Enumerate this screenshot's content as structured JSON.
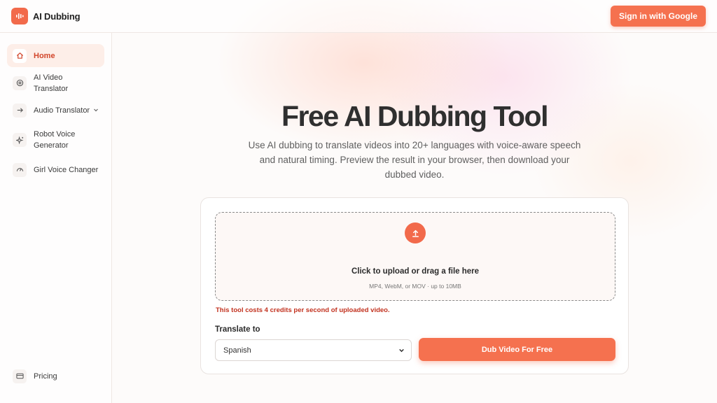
{
  "header": {
    "brand_name": "AI Dubbing",
    "signin_label": "Sign in with Google"
  },
  "sidebar": {
    "items": [
      {
        "label": "Home",
        "icon": "home-icon",
        "active": true
      },
      {
        "label": "AI Video Translator",
        "icon": "target-icon"
      },
      {
        "label": "Audio Translator",
        "icon": "arrow-right-icon",
        "has_submenu": true
      },
      {
        "label": "Robot Voice Generator",
        "icon": "sparkle-icon"
      },
      {
        "label": "Girl Voice Changer",
        "icon": "gauge-icon"
      }
    ],
    "bottom_item": {
      "label": "Pricing",
      "icon": "credit-card-icon"
    }
  },
  "main": {
    "title": "Free AI Dubbing Tool",
    "subtitle": "Use AI dubbing to translate videos into 20+ languages with voice-aware speech and natural timing. Preview the result in your browser, then download your dubbed video.",
    "upload": {
      "title": "Click to upload or drag a file here",
      "hint": "MP4, WebM, or MOV · up to 10MB"
    },
    "cost_note": "This tool costs 4 credits per second of uploaded video.",
    "translate_label": "Translate to",
    "language_value": "Spanish",
    "dub_button": "Dub Video For Free"
  },
  "colors": {
    "accent": "#f26a4b",
    "accent_button": "#f5714f",
    "warning_text": "#c2321f",
    "active_nav_bg": "#fdeee8"
  }
}
